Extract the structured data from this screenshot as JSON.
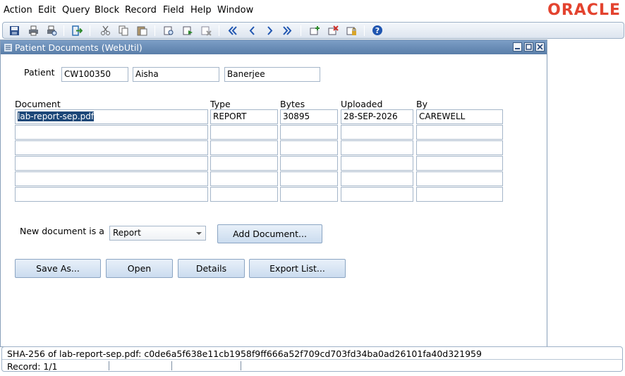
{
  "menu": [
    "Action",
    "Edit",
    "Query",
    "Block",
    "Record",
    "Field",
    "Help",
    "Window"
  ],
  "brand": "ORACLE",
  "brand_color": "#e3432f",
  "toolbar": {
    "icons": [
      "save-icon",
      "print-icon",
      "print-preview-icon",
      "exit-icon",
      "cut-icon",
      "copy-icon",
      "paste-icon",
      "enter-query-icon",
      "execute-query-icon",
      "cancel-query-icon",
      "first-record-icon",
      "previous-record-icon",
      "next-record-icon",
      "last-record-icon",
      "insert-record-icon",
      "delete-record-icon",
      "lock-record-icon",
      "help-icon"
    ]
  },
  "window": {
    "title": "Patient Documents (WebUtil)"
  },
  "patient": {
    "label": "Patient",
    "id": "CW100350",
    "first_name": "Aisha",
    "last_name": "Banerjee"
  },
  "table": {
    "headers": {
      "document": "Document",
      "type": "Type",
      "bytes": "Bytes",
      "uploaded": "Uploaded",
      "by": "By"
    },
    "rows": [
      {
        "document": "lab-report-sep.pdf",
        "type": "REPORT",
        "bytes": "30895",
        "uploaded": "28-SEP-2026",
        "by": "CAREWELL"
      },
      {
        "document": "",
        "type": "",
        "bytes": "",
        "uploaded": "",
        "by": ""
      },
      {
        "document": "",
        "type": "",
        "bytes": "",
        "uploaded": "",
        "by": ""
      },
      {
        "document": "",
        "type": "",
        "bytes": "",
        "uploaded": "",
        "by": ""
      },
      {
        "document": "",
        "type": "",
        "bytes": "",
        "uploaded": "",
        "by": ""
      },
      {
        "document": "",
        "type": "",
        "bytes": "",
        "uploaded": "",
        "by": ""
      }
    ]
  },
  "new_doc": {
    "label": "New document is a",
    "selected": "Report",
    "add_button": "Add Document..."
  },
  "actions": {
    "save_as": "Save As...",
    "open": "Open",
    "details": "Details",
    "export": "Export List..."
  },
  "status": {
    "message": "SHA-256 of lab-report-sep.pdf: c0de6a5f638e11cb1958f9ff666a52f709cd703fd34ba0ad26101fa40d321959",
    "record": "Record: 1/1"
  }
}
